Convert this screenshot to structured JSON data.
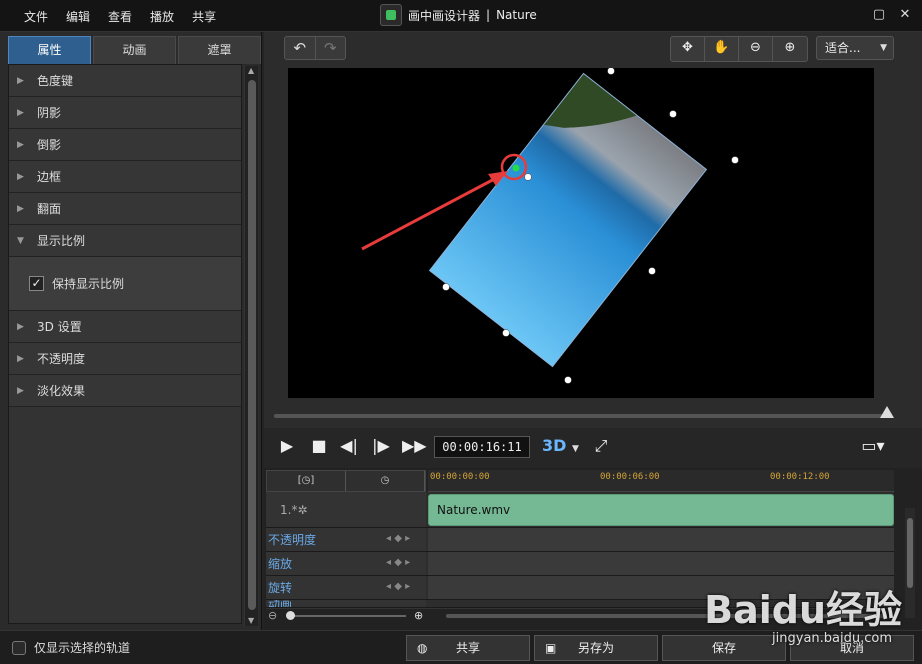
{
  "titlebar": {
    "menu": [
      "文件",
      "编辑",
      "查看",
      "播放",
      "共享"
    ],
    "app_name": "画中画设计器",
    "separator": "|",
    "document_name": "Nature",
    "min_icon": "restore-icon",
    "close_icon": "close-icon"
  },
  "left_panel": {
    "tabs": [
      "属性",
      "动画",
      "遮罩"
    ],
    "active_tab": "属性",
    "properties": [
      {
        "label": "色度键",
        "expanded": false
      },
      {
        "label": "阴影",
        "expanded": false
      },
      {
        "label": "倒影",
        "expanded": false
      },
      {
        "label": "边框",
        "expanded": false
      },
      {
        "label": "翻面",
        "expanded": false
      },
      {
        "label": "显示比例",
        "expanded": true
      },
      {
        "label": "3D 设置",
        "expanded": false
      },
      {
        "label": "不透明度",
        "expanded": false
      },
      {
        "label": "淡化效果",
        "expanded": false
      }
    ],
    "keep_ratio_label": "保持显示比例",
    "keep_ratio_checked": true
  },
  "toolbar": {
    "undo_icon": "undo-icon",
    "redo_icon": "redo-icon",
    "tools": [
      "move-icon",
      "hand-icon",
      "zoom-out-icon",
      "zoom-in-icon"
    ],
    "fit_label": "适合..."
  },
  "player": {
    "timecode": "00:00:16:11",
    "mode_3d": "3D"
  },
  "timeline": {
    "ruler": [
      "00:00:00:00",
      "00:00:06:00",
      "00:00:12:00"
    ],
    "track_number": "1.",
    "clip_name": "Nature.wmv",
    "tracks": [
      "不透明度",
      "缩放",
      "旋转",
      "动画"
    ]
  },
  "bottom": {
    "show_selected_only": "仅显示选择的轨道",
    "share": "共享",
    "save_as": "另存为",
    "save": "保存",
    "cancel": "取消"
  },
  "watermark": {
    "brand": "Baidu经验",
    "url": "jingyan.baidu.com"
  },
  "colors": {
    "active_tab": "#2e5f8f",
    "clip": "#74b894",
    "timecode_ruler": "#d4a437",
    "annotation_arrow": "#e83b3b",
    "anchor_point": "#22dd44"
  }
}
